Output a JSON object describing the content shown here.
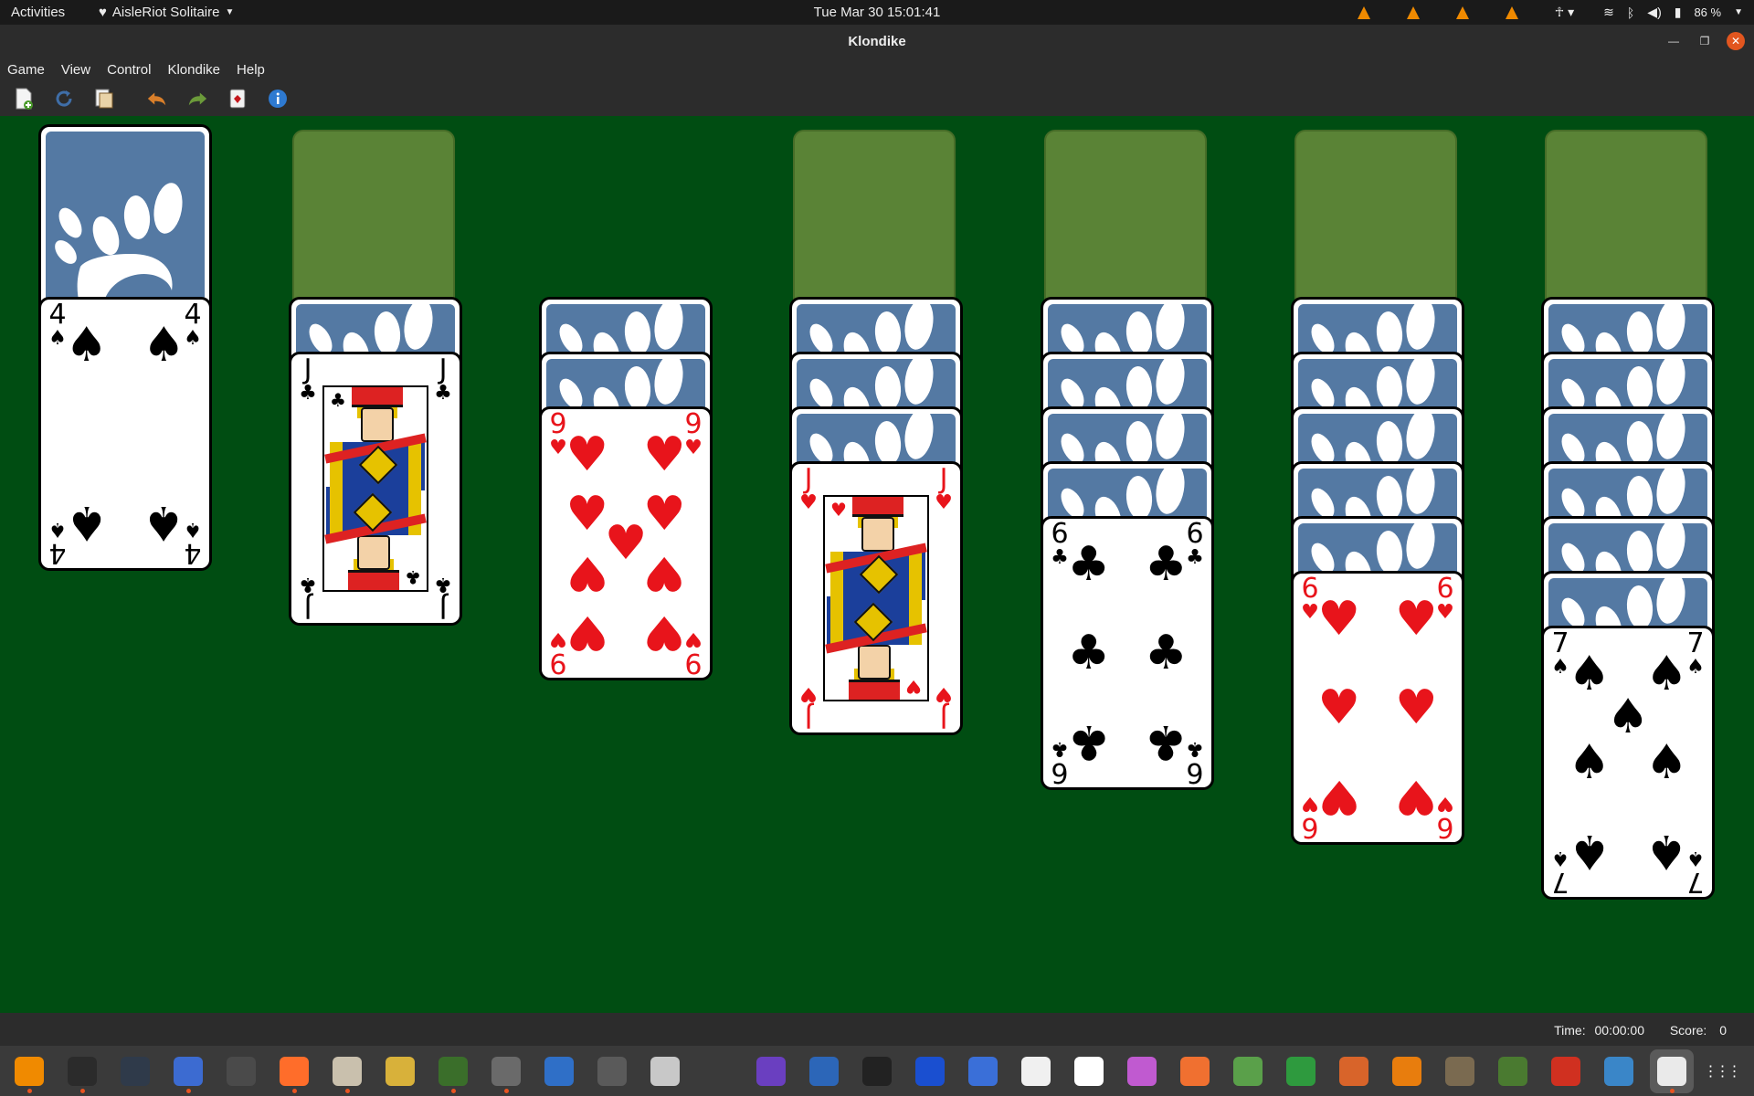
{
  "topbar": {
    "activities": "Activities",
    "app_name": "AisleRiot Solitaire",
    "clock": "Tue Mar 30  15:01:41",
    "battery": "86 %"
  },
  "window": {
    "title": "Klondike"
  },
  "menubar": {
    "items": [
      "Game",
      "View",
      "Control",
      "Klondike",
      "Help"
    ]
  },
  "toolbar": {
    "buttons": [
      "new-game-icon",
      "restart-icon",
      "select-game-icon",
      "undo-icon",
      "redo-icon",
      "hint-icon",
      "info-icon"
    ]
  },
  "game": {
    "foundations": 4,
    "tableau": [
      {
        "face_down": 0,
        "face_up": {
          "rank": "4",
          "suit": "♠",
          "color": "black"
        }
      },
      {
        "face_down": 1,
        "face_up": {
          "rank": "J",
          "suit": "♣",
          "color": "black"
        }
      },
      {
        "face_down": 2,
        "face_up": {
          "rank": "9",
          "suit": "♥",
          "color": "red"
        }
      },
      {
        "face_down": 3,
        "face_up": {
          "rank": "J",
          "suit": "♥",
          "color": "red"
        }
      },
      {
        "face_down": 4,
        "face_up": {
          "rank": "6",
          "suit": "♣",
          "color": "black"
        }
      },
      {
        "face_down": 5,
        "face_up": {
          "rank": "6",
          "suit": "♥",
          "color": "red"
        }
      },
      {
        "face_down": 6,
        "face_up": {
          "rank": "7",
          "suit": "♠",
          "color": "black"
        }
      }
    ],
    "felt_color": "#004d12",
    "card_back_color": "#5479a3"
  },
  "status": {
    "time_label": "Time:",
    "time_value": "00:00:00",
    "score_label": "Score:",
    "score_value": "0"
  },
  "dock": {
    "apps": [
      "vlc-icon",
      "terminal-icon",
      "system-monitor-icon",
      "text-editor-icon",
      "clock-icon",
      "firefox-icon",
      "files-icon",
      "calculator-icon",
      "patience-icon",
      "settings-icon",
      "writer-icon",
      "document-viewer-icon",
      "charts-icon",
      "software-updater-icon",
      "cheese-icon",
      "virtualbox-icon",
      "inkscape-icon",
      "audio-icon",
      "screenshot-icon",
      "character-map-icon",
      "typora-icon",
      "tweaks-icon",
      "software-center-icon",
      "image-viewer-icon",
      "calc-icon",
      "impress-icon",
      "blender-icon",
      "gimp-icon",
      "minecraft-icon",
      "mario-icon",
      "document-scanner-icon",
      "aisleriot-icon",
      "show-apps-icon"
    ]
  }
}
